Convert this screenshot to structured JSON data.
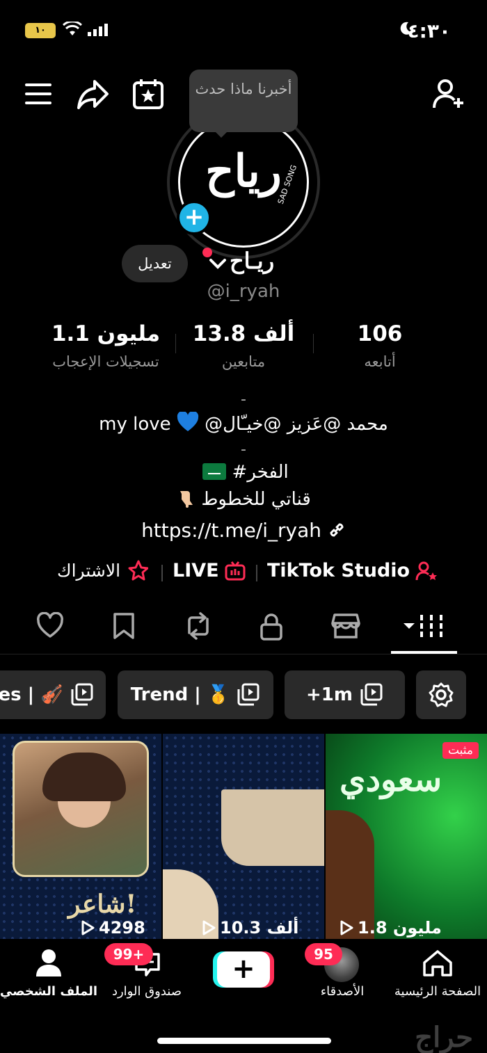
{
  "status_bar": {
    "time": "٤:٣٠",
    "battery": "١٠"
  },
  "tooltip": {
    "text": "أخبرنا ماذا حدث"
  },
  "avatar": {
    "logo_text": "رياح",
    "logo_sub": "SAD SONG"
  },
  "profile": {
    "display_name": "ريـاح",
    "username": "@i_ryah",
    "edit_label": "تعديل"
  },
  "stats": [
    {
      "value": "106",
      "label": "أتابعه"
    },
    {
      "value": "13.8 ألف",
      "label": "متابعين"
    },
    {
      "value": "1.1 مليون",
      "label": "تسجيلات الإعجاب"
    }
  ],
  "bio": {
    "dash1": "-",
    "mentions": "@محمد @عَزيز  @خيـّال",
    "love": "my love",
    "dash2": "-",
    "hashtag": "#الفخر",
    "channel": "قناتي للخطوط",
    "link": "https://t.me/i_ryah"
  },
  "links": {
    "studio": "TikTok Studio",
    "live": "LIVE",
    "subscribe": "الاشتراك"
  },
  "tabs": [
    "videos",
    "shop",
    "private",
    "reposts",
    "favorites",
    "liked"
  ],
  "playlists": [
    {
      "label": "es | 🎻"
    },
    {
      "label": "Trend | 🥇"
    },
    {
      "label": "+1m"
    }
  ],
  "videos": [
    {
      "views": "4298",
      "overlay_text": "شاعر!"
    },
    {
      "views": "10.3 ألف"
    },
    {
      "views": "1.8 مليون",
      "pinned": "مثبت",
      "overlay_text": "سعودي"
    }
  ],
  "nav": {
    "home": "الصفحة الرئيسية",
    "friends": "الأصدقاء",
    "friends_badge": "95",
    "inbox": "صندوق الوارد",
    "inbox_badge": "99+",
    "profile": "الملف الشخصي"
  },
  "watermark": "حراج",
  "colors": {
    "accent": "#fe2c55",
    "cyan": "#25f4ee",
    "plus_badge": "#20b4e6"
  }
}
